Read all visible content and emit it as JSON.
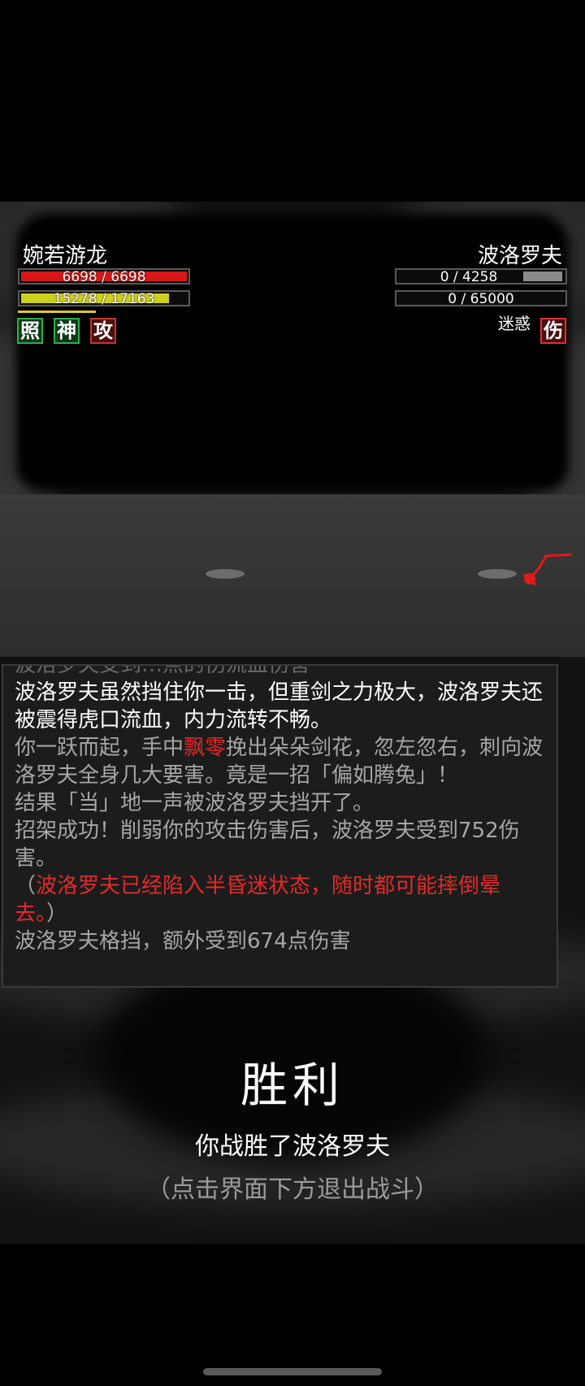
{
  "player": {
    "name": "婉若游龙",
    "hp_text": "6698 / 6698",
    "hp_fraction": 1.0,
    "mp_text": "15278 / 17163",
    "mp_fraction": 0.89,
    "buffs": [
      {
        "label": "照",
        "color": "#2fae4a"
      },
      {
        "label": "神",
        "color": "#2fae4a"
      },
      {
        "label": "攻",
        "color": "#c0392b"
      }
    ]
  },
  "enemy": {
    "name": "波洛罗夫",
    "hp_text": "0 / 4258",
    "mp_text": "0 / 65000",
    "buffs": [
      {
        "label": "伤",
        "color": "#e03030"
      }
    ],
    "status": "迷惑"
  },
  "log": {
    "partial_line": "波洛罗夫受到…点的伤流血伤害",
    "entries": [
      {
        "segments": [
          {
            "text": "波洛罗夫虽然挡住你一击，但重剑之力极大，波洛罗夫还被震得虎口流血，内力流转不畅。",
            "style": "w"
          }
        ]
      },
      {
        "segments": [
          {
            "text": "你一跃而起，手中",
            "style": "g"
          },
          {
            "text": "飘零",
            "style": "r"
          },
          {
            "text": "挽出朵朵剑花，忽左忽右，刺向波洛罗夫全身几大要害。竟是一招「偏如腾兔」！",
            "style": "g"
          }
        ]
      },
      {
        "segments": [
          {
            "text": "结果「当」地一声被波洛罗夫挡开了。",
            "style": "g"
          }
        ]
      },
      {
        "segments": [
          {
            "text": "招架成功！削弱你的攻击伤害后，波洛罗夫受到752伤害。",
            "style": "g"
          }
        ]
      },
      {
        "segments": [
          {
            "text": "（",
            "style": "g"
          },
          {
            "text": "波洛罗夫已经陷入半昏迷状态，随时都可能摔倒晕去。",
            "style": "r"
          },
          {
            "text": "）",
            "style": "g"
          }
        ]
      },
      {
        "segments": [
          {
            "text": "波洛罗夫格挡，额外受到674点伤害",
            "style": "g"
          }
        ]
      }
    ]
  },
  "victory": {
    "title": "胜利",
    "subtitle": "你战胜了波洛罗夫",
    "hint": "（点击界面下方退出战斗）"
  }
}
